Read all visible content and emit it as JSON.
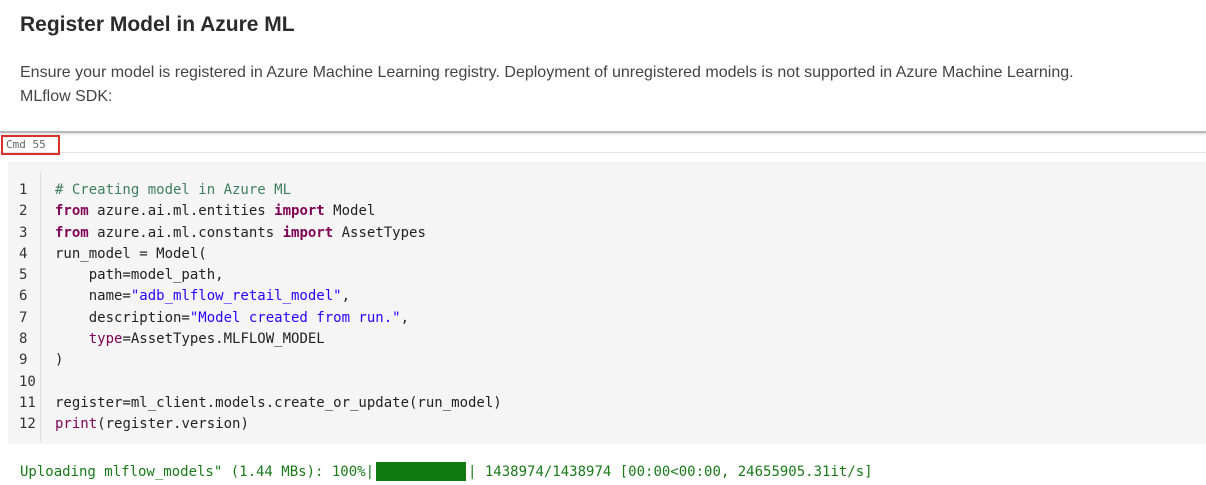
{
  "markdown": {
    "title": "Register Model in Azure ML",
    "paragraph_line1": "Ensure your model is registered in Azure Machine Learning registry. Deployment of unregistered models is not supported in Azure Machine Learning.",
    "paragraph_line2": "MLflow SDK:"
  },
  "cell": {
    "cmd_label": "Cmd 55",
    "line_numbers": [
      "1",
      "2",
      "3",
      "4",
      "5",
      "6",
      "7",
      "8",
      "9",
      "10",
      "11",
      "12"
    ],
    "code": {
      "l1_comment": "# Creating model in Azure ML",
      "l2_kw1": "from",
      "l2_mod": " azure.ai.ml.entities ",
      "l2_kw2": "import",
      "l2_name": " Model",
      "l3_kw1": "from",
      "l3_mod": " azure.ai.ml.constants ",
      "l3_kw2": "import",
      "l3_name": " AssetTypes",
      "l4": "run_model = Model(",
      "l5": "    path=model_path,",
      "l6_pre": "    name=",
      "l6_str": "\"adb_mlflow_retail_model\"",
      "l6_post": ",",
      "l7_pre": "    description=",
      "l7_str": "\"Model created from run.\"",
      "l7_post": ",",
      "l8_kw": "    type",
      "l8_post": "=AssetTypes.MLFLOW_MODEL",
      "l9": ")",
      "l10": "",
      "l11": "register=ml_client.models.create_or_update(run_model)",
      "l12_fn": "print",
      "l12_post": "(register.version)"
    },
    "output": {
      "prefix": "Uploading mlflow_models\" (1.44 MBs): 100%|",
      "progress": 1.0,
      "suffix": "| 1438974/1438974 [00:00<00:00, 24655905.31it/s]"
    }
  },
  "colors": {
    "keyword": "#7f0055",
    "string": "#2a00ff",
    "comment": "#3f7f5f",
    "output": "#1a7a1a",
    "highlight_border": "#d9302c"
  }
}
